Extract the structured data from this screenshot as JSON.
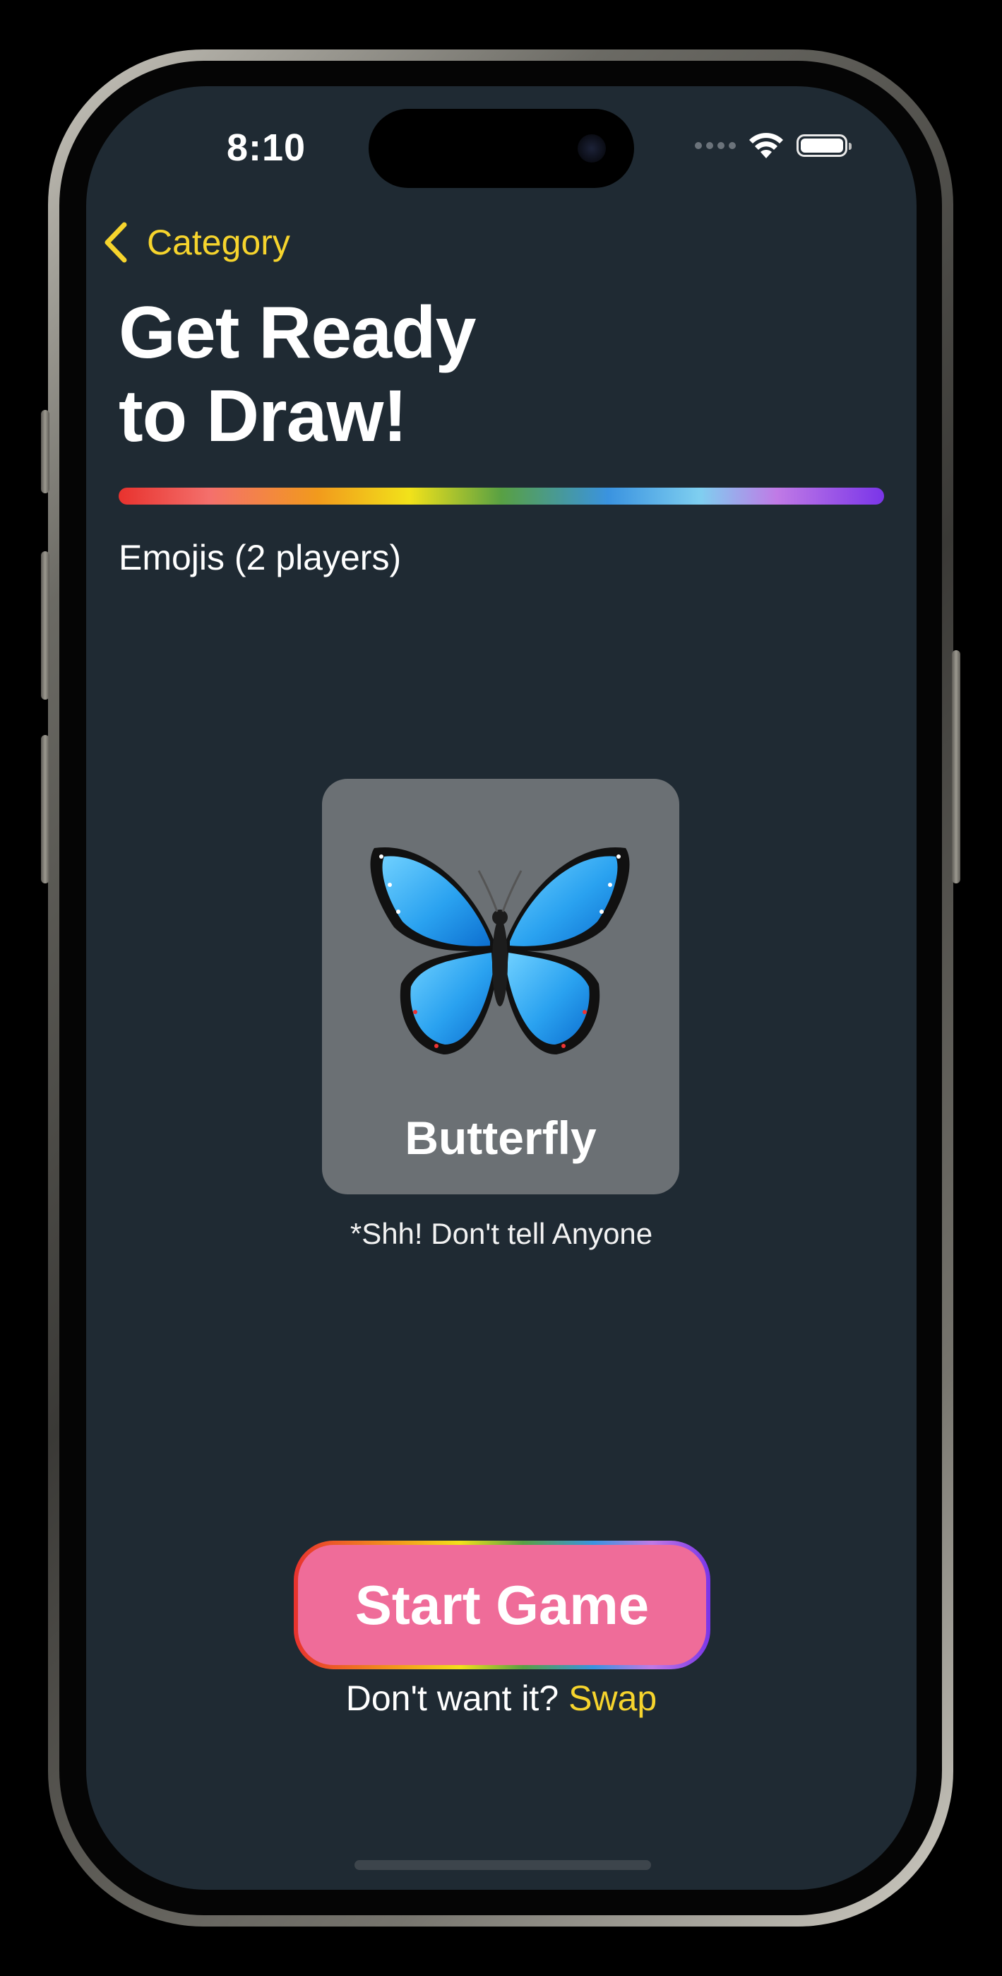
{
  "status_bar": {
    "time": "8:10",
    "wifi_icon": "wifi-icon",
    "battery_icon": "battery-icon"
  },
  "nav": {
    "back_label": "Category",
    "back_icon": "chevron-left-icon"
  },
  "header": {
    "title_line1": "Get Ready",
    "title_line2": "to Draw!",
    "subtitle": "Emojis (2 players)"
  },
  "card": {
    "emoji_icon": "butterfly-icon",
    "label": "Butterfly"
  },
  "hint": "*Shh! Don't tell Anyone",
  "actions": {
    "start_label": "Start Game",
    "swap_prompt": "Don't want it?",
    "swap_label": "Swap"
  },
  "colors": {
    "background": "#1f2a33",
    "accent_yellow": "#f6d42d",
    "start_button": "#ef6c99",
    "card": "#6b7074"
  }
}
